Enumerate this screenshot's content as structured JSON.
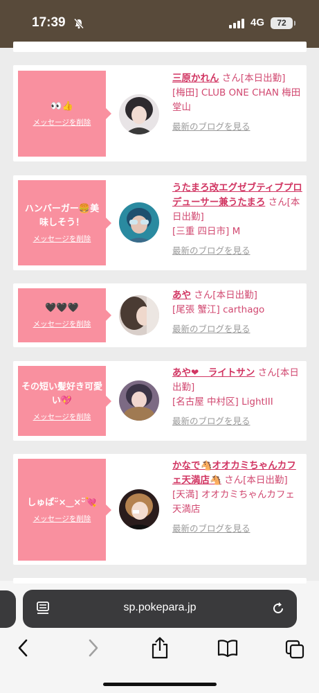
{
  "status_bar": {
    "time": "17:39",
    "network": "4G",
    "battery": "72"
  },
  "delete_label": "メッセージを削除",
  "san_label": "さん",
  "blog_label": "最新のブログを見る",
  "cards": [
    {
      "message": "👀👍",
      "name": "三原かれん",
      "status": "[本日出勤]",
      "shop": "[梅田] CLUB ONE CHAN 梅田堂山"
    },
    {
      "message": "ハンバーガー🍔美味しそう！",
      "name": "うたまろ改エグゼブティブプロデューサー兼うたまろ",
      "status": "[本日出勤]",
      "shop": "[三重 四日市] M"
    },
    {
      "message": "🖤🖤🖤",
      "name": "あや",
      "status": "[本日出勤]",
      "shop": "[尾張 蟹江] carthago"
    },
    {
      "message": "その短い髪好き可愛い💖",
      "name": "あや❤︎　ライトサン",
      "status": "[本日出勤]",
      "shop": "[名古屋 中村区] LightIII"
    },
    {
      "message": "しゅぱᵕ̈×‿×ᵕ̈💘",
      "name": "かなで🐴オオカミちゃんカフェ天満店🐴",
      "status": "[本日出勤]",
      "shop": "[天満] オオカミちゃんカフェ天満店"
    }
  ],
  "browser": {
    "url": "sp.pokepara.jp"
  },
  "colors": {
    "status_bar": "#584a3a",
    "bubble": "#f9909f",
    "name": "#d13562",
    "page_bg": "#ececec"
  }
}
